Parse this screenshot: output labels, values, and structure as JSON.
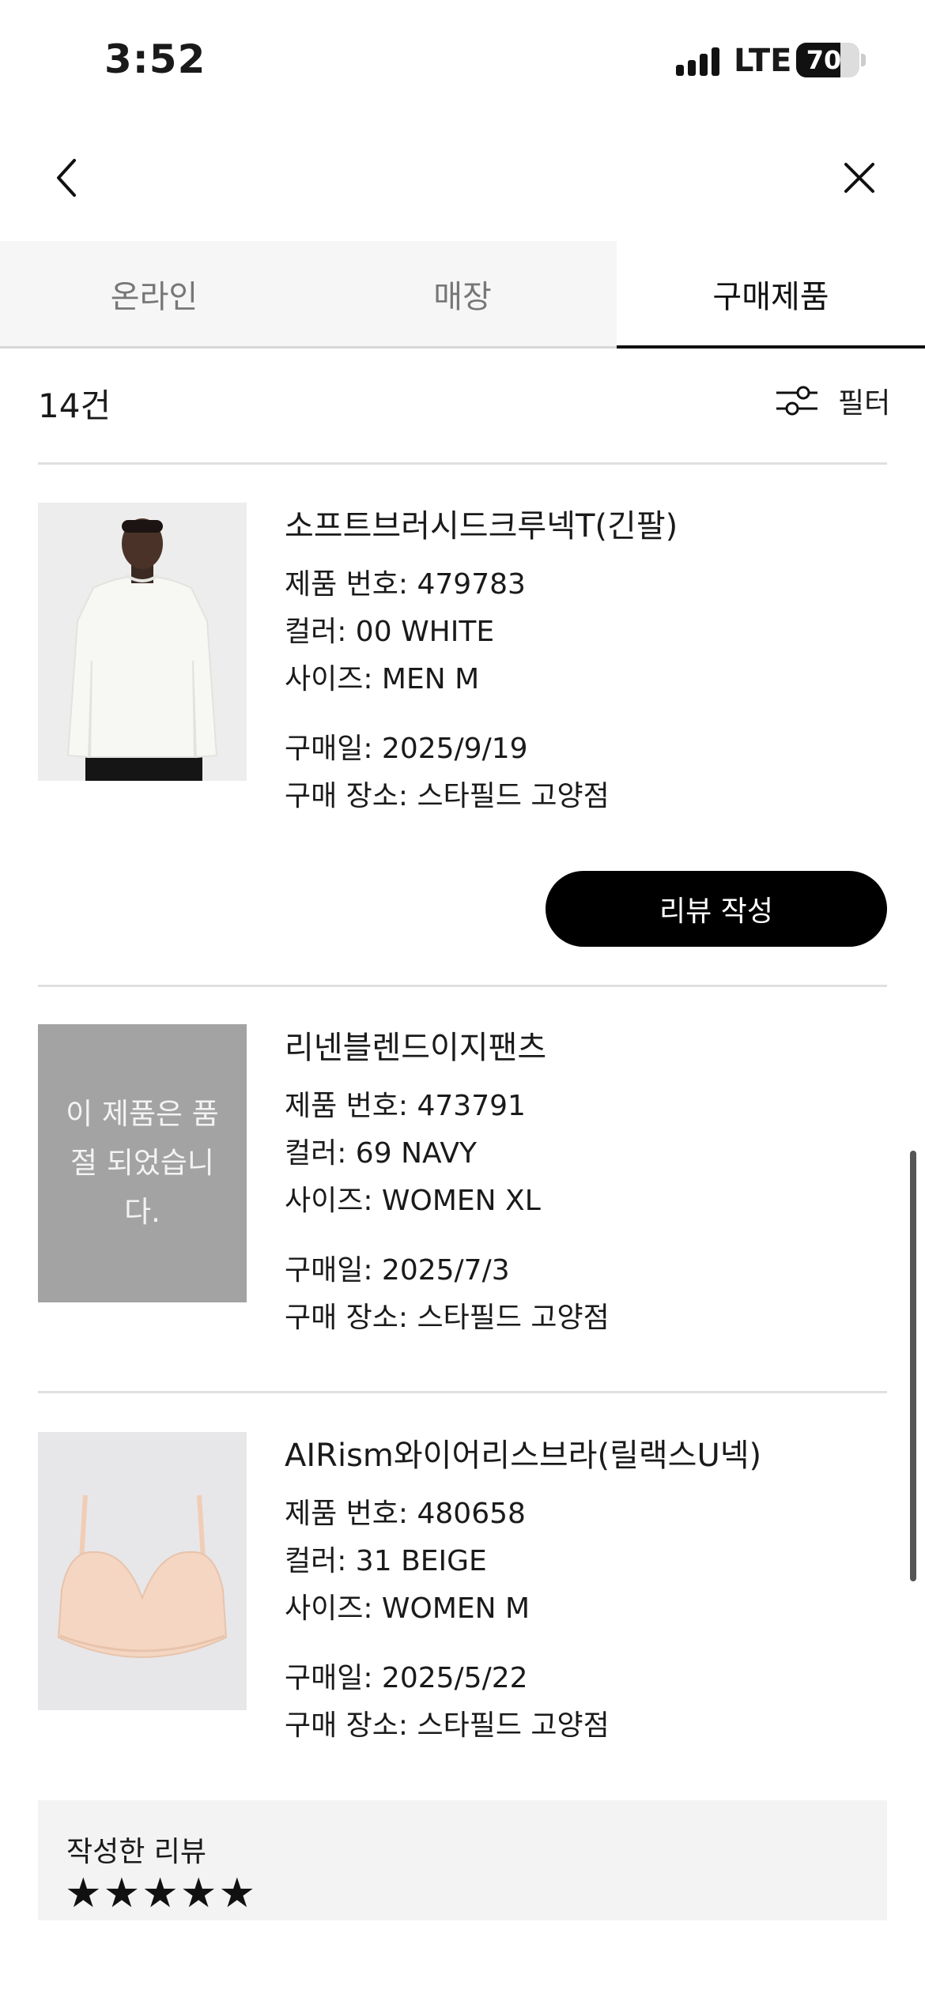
{
  "status_bar": {
    "time": "3:52",
    "network": "LTE",
    "battery": "70",
    "battery_level": 0.7
  },
  "nav": {
    "back_icon": "chevron-left-icon",
    "close_icon": "close-icon"
  },
  "tabs": [
    {
      "label": "온라인",
      "active": false
    },
    {
      "label": "매장",
      "active": false
    },
    {
      "label": "구매제품",
      "active": true
    }
  ],
  "list_header": {
    "count": "14건",
    "filter_label": "필터",
    "filter_icon": "sliders-icon"
  },
  "products": [
    {
      "name": "소프트브러시드크루넥T(긴팔)",
      "product_number": "제품 번호: 479783",
      "color": "컬러: 00 WHITE",
      "size": "사이즈: MEN M",
      "purchase_date": "구매일: 2025/9/19",
      "purchase_place": "구매 장소: 스타필드 고양점",
      "button_label": "리뷰 작성"
    },
    {
      "name": "리넨블렌드이지팬츠",
      "sold_out_text": "이 제품은 품절 되었습니다.",
      "product_number": "제품 번호: 473791",
      "color": "컬러: 69 NAVY",
      "size": "사이즈: WOMEN XL",
      "purchase_date": "구매일: 2025/7/3",
      "purchase_place": "구매 장소: 스타필드 고양점"
    },
    {
      "name": "AIRism와이어리스브라(릴랙스U넥)",
      "product_number": "제품 번호: 480658",
      "color": "컬러: 31 BEIGE",
      "size": "사이즈: WOMEN M",
      "purchase_date": "구매일: 2025/5/22",
      "purchase_place": "구매 장소: 스타필드 고양점"
    }
  ],
  "written_review": {
    "title": "작성한 리뷰",
    "stars": "★★★★★",
    "rating": 5
  },
  "colors": {
    "accent": "#000000",
    "tab_inactive_bg": "#f6f6f6",
    "sold_out_bg": "#a3a3a3"
  }
}
